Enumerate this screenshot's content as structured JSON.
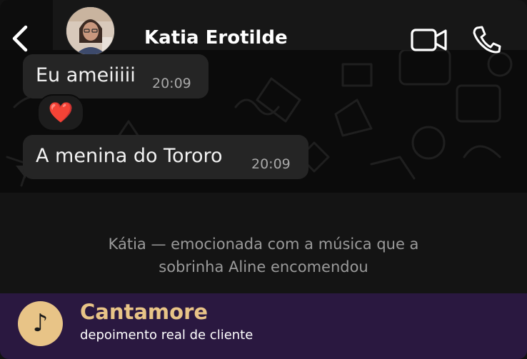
{
  "header": {
    "contact_name": "Katia Erotilde",
    "back_icon": "chevron-left-icon",
    "video_icon": "video-camera-icon",
    "call_icon": "phone-icon"
  },
  "messages": [
    {
      "text": "Eu ameiiiii",
      "time": "20:09"
    },
    {
      "text": "A menina do Tororo",
      "time": "20:09"
    }
  ],
  "reaction": {
    "emoji": "❤️",
    "icon": "heart-icon"
  },
  "caption": {
    "line1": "Kátia — emocionada com a música que a",
    "line2": "sobrinha Aline encomendou"
  },
  "footer": {
    "brand": "Cantamore",
    "subtitle": "depoimento real de cliente",
    "icon": "music-note-icon",
    "note_glyph": "♪"
  },
  "colors": {
    "footer_bg": "#2a1840",
    "accent": "#e8c487",
    "bubble": "#252525"
  }
}
